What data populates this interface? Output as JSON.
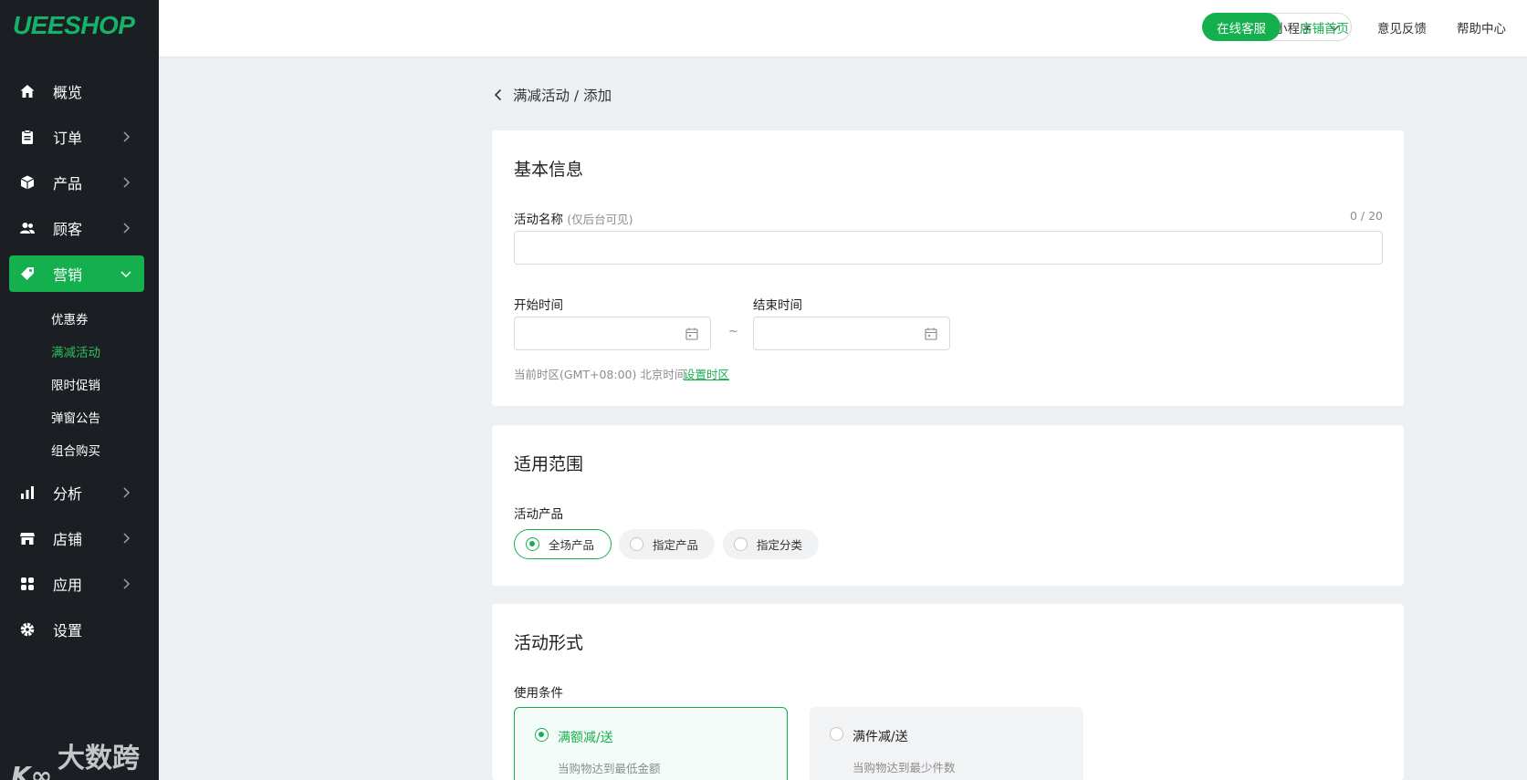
{
  "brand": {
    "logo_text": "UEESHOP",
    "accent": "#15b04e",
    "sidebar_bg": "#1b1f24"
  },
  "sidebar": {
    "items": [
      {
        "label": "概览",
        "icon": "home-icon"
      },
      {
        "label": "订单",
        "icon": "clipboard-icon"
      },
      {
        "label": "产品",
        "icon": "box-icon"
      },
      {
        "label": "顾客",
        "icon": "users-icon"
      },
      {
        "label": "营销",
        "icon": "tag-icon"
      },
      {
        "label": "分析",
        "icon": "bar-chart-icon"
      },
      {
        "label": "店铺",
        "icon": "store-icon"
      },
      {
        "label": "应用",
        "icon": "apps-icon"
      },
      {
        "label": "设置",
        "icon": "gear-icon"
      }
    ],
    "marketing_sub": [
      "优惠券",
      "满减活动",
      "限时促销",
      "弹窗公告",
      "组合购买"
    ],
    "active_item": "营销",
    "active_sub": "满减活动"
  },
  "watermark": {
    "text": "大数跨境"
  },
  "topbar": {
    "mini_program": "小程序",
    "online_service": "在线客服",
    "store_home": "店铺首页",
    "feedback": "意见反馈",
    "help_center": "帮助中心"
  },
  "breadcrumb": {
    "text": "满减活动 / 添加"
  },
  "basic_info": {
    "title": "基本信息",
    "name_label": "活动名称",
    "name_hint": "(仅后台可见)",
    "name_value": "",
    "name_counter": "0 / 20",
    "start_label": "开始时间",
    "end_label": "结束时间",
    "range_separator": "~",
    "timezone_text": "当前时区(GMT+08:00) 北京时间",
    "timezone_link": "设置时区"
  },
  "scope": {
    "title": "适用范围",
    "product_label": "活动产品",
    "options": [
      "全场产品",
      "指定产品",
      "指定分类"
    ],
    "selected": "全场产品"
  },
  "form": {
    "title": "活动形式",
    "condition_label": "使用条件",
    "conditions": [
      {
        "title": "满额减/送",
        "desc": "当购物达到最低金额"
      },
      {
        "title": "满件减/送",
        "desc": "当购物达到最少件数"
      }
    ],
    "selected": "满额减/送"
  }
}
